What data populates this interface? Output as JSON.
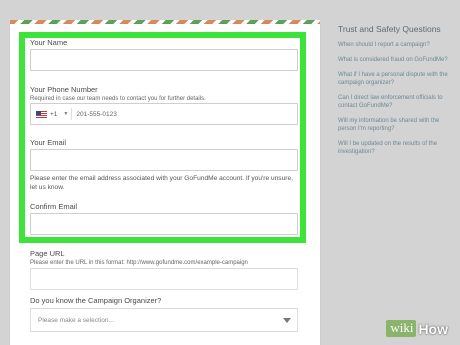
{
  "form": {
    "name_label": "Your Name",
    "phone_label": "Your Phone Number",
    "phone_help": "Required in case our team needs to contact you for further details.",
    "phone_prefix": "+1",
    "phone_placeholder": "201-555-0123",
    "email_label": "Your Email",
    "email_help": "Please enter the email address associated with your GoFundMe account. If you're unsure, let us know.",
    "confirm_email_label": "Confirm Email",
    "page_url_label": "Page URL",
    "page_url_help": "Please enter the URL in this format: http://www.gofundme.com/example-campaign",
    "organizer_label": "Do you know the Campaign Organizer?",
    "organizer_select": "Please make a selection..."
  },
  "sidebar": {
    "title": "Trust and Safety Questions",
    "links": [
      "When should I report a campaign?",
      "What is considered fraud on GoFundMe?",
      "What if I have a personal dispute with the campaign organizer?",
      "Can I direct law enforcement officials to contact GoFundMe?",
      "Will my information be shared with the person I'm reporting?",
      "Will I be updated on the results of the investigation?"
    ]
  },
  "watermark": {
    "wiki": "wiki",
    "how": "How"
  },
  "colors": {
    "highlight": "#3ee33a",
    "background": "#d3d3d3",
    "link": "#6e8794"
  }
}
